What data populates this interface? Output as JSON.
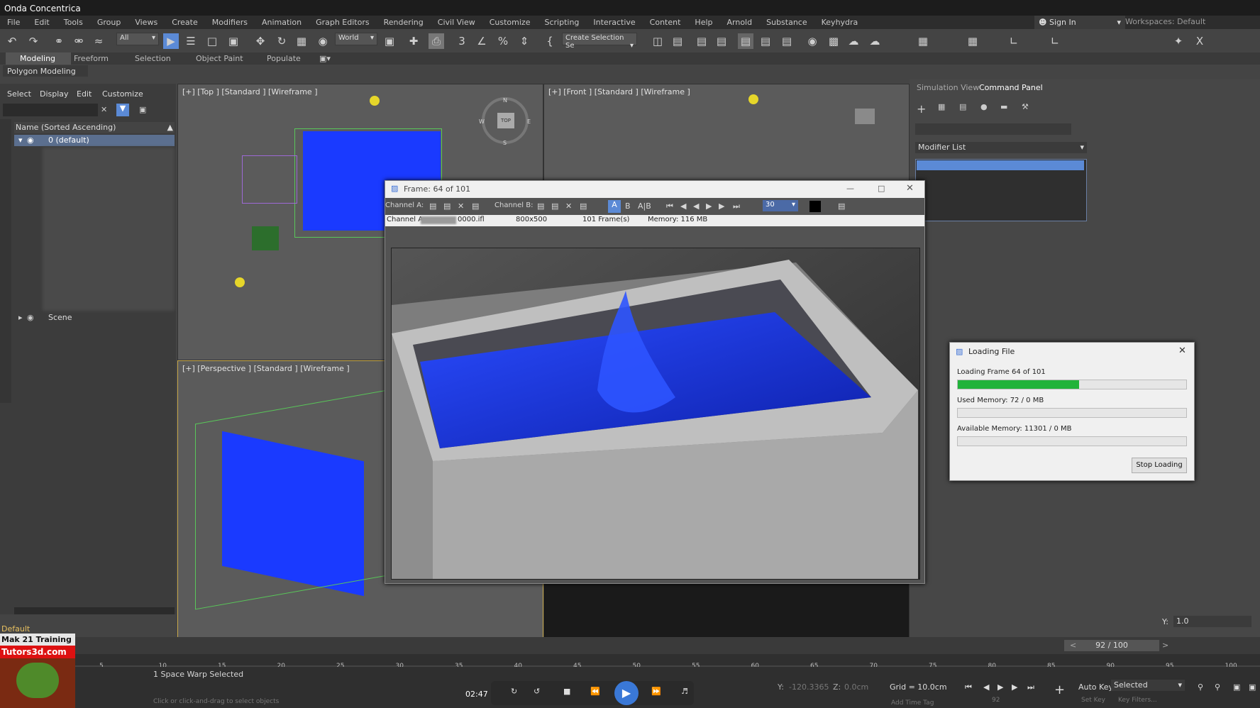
{
  "app": {
    "title": "Onda Concentrica"
  },
  "menu": [
    "File",
    "Edit",
    "Tools",
    "Group",
    "Views",
    "Create",
    "Modifiers",
    "Animation",
    "Graph Editors",
    "Rendering",
    "Civil View",
    "Customize",
    "Scripting",
    "Interactive",
    "Content",
    "Help",
    "Arnold",
    "Substance",
    "Keyhydra"
  ],
  "account": {
    "sign_in": "Sign In",
    "workspaces_label": "Workspaces:",
    "workspace_value": "Default"
  },
  "toolbar": {
    "filter_value": "All",
    "coord_system": "World",
    "create_selection_set": "Create Selection Se"
  },
  "ribbon": {
    "tabs": [
      "Modeling",
      "Freeform",
      "Selection",
      "Object Paint",
      "Populate"
    ],
    "subtitle": "Polygon Modeling"
  },
  "scene_explorer": {
    "tabs": [
      "Select",
      "Display",
      "Edit",
      "Customize"
    ],
    "column_header": "Name (Sorted Ascending)",
    "layer_default": "0 (default)",
    "scene_row": "Scene",
    "layer_footer": "Default"
  },
  "viewports": {
    "top": "[+] [Top ] [Standard ] [Wireframe ]",
    "front": "[+] [Front ] [Standard ] [Wireframe ]",
    "perspective": "[+] [Perspective ] [Standard ] [Wireframe ]",
    "viewcube_label": "TOP",
    "compass": [
      "N",
      "W",
      "E",
      "S"
    ]
  },
  "command_panel": {
    "tabs": [
      "Simulation View",
      "Command Panel"
    ],
    "modifier_list": "Modifier List",
    "y_label": "Y:",
    "y_value": "1.0"
  },
  "frame_window": {
    "title": "Frame: 64 of 101",
    "channel_a_label": "Channel A:",
    "channel_b_label": "Channel B:",
    "frame_rate": "30",
    "info_channel": "Channel A:",
    "info_file": "0000.ifl",
    "info_size": "800x500",
    "info_frames": "101 Frame(s)",
    "info_memory": "Memory: 116 MB"
  },
  "loading_dialog": {
    "title": "Loading File",
    "loading_text": "Loading Frame 64 of 101",
    "loading_progress": 0.53,
    "used_memory": "Used Memory:  72 / 0 MB",
    "available_memory": "Available Memory:  11301 / 0 MB",
    "stop_button": "Stop Loading"
  },
  "timeline": {
    "slider": "92 / 100",
    "ticks": [
      "5",
      "10",
      "15",
      "20",
      "25",
      "30",
      "35",
      "40",
      "45",
      "50",
      "55",
      "60",
      "65",
      "70",
      "75",
      "80",
      "85",
      "90",
      "95",
      "100"
    ]
  },
  "status": {
    "selection": "1 Space Warp Selected",
    "prompt": "Click or click-and-drag to select objects",
    "time": "02:47",
    "y_label": "Y:",
    "y_value": "-120.3365",
    "z_label": "Z:",
    "z_value": "0.0cm",
    "grid": "Grid = 10.0cm",
    "add_time_tag": "Add Time Tag",
    "auto_key": "Auto Key",
    "selected": "Selected",
    "set_key": "Set Key",
    "key_filters": "Key Filters...",
    "frame_field": "92"
  },
  "logo": {
    "line1": "Mak 21 Training",
    "line2": "Tutors3d.com"
  },
  "colors": {
    "accent_blue": "#5b8ad6",
    "progress_green": "#21b33a",
    "water_blue": "#1a3aff"
  }
}
